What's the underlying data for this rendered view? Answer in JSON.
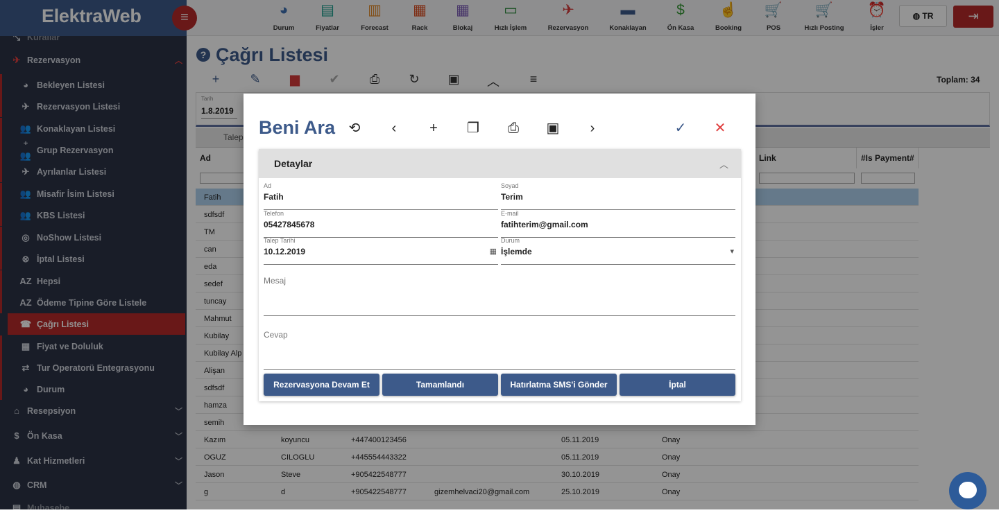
{
  "app": {
    "logo": "ElektraWeb",
    "menu_icon": "hamburger-icon"
  },
  "sidebar": {
    "partial_top": "Kurallar",
    "reservation_section": "Rezervasyon",
    "items": [
      {
        "label": "Bekleyen Listesi",
        "icon": "pie-icon"
      },
      {
        "label": "Rezervasyon Listesi",
        "icon": "plane-land-icon"
      },
      {
        "label": "Konaklayan Listesi",
        "icon": "people-icon"
      },
      {
        "label": "Grup Rezervasyon",
        "icon": "group-add-icon"
      },
      {
        "label": "Ayrılanlar Listesi",
        "icon": "plane-takeoff-icon"
      },
      {
        "label": "Misafir İsim Listesi",
        "icon": "people-outline-icon"
      },
      {
        "label": "KBS Listesi",
        "icon": "people-outline-icon"
      },
      {
        "label": "NoShow Listesi",
        "icon": "eye-off-icon"
      },
      {
        "label": "İptal Listesi",
        "icon": "cancel-icon"
      },
      {
        "label": "Hepsi",
        "icon": "az-icon"
      },
      {
        "label": "Ödeme Tipine Göre Listele",
        "icon": "az-icon"
      },
      {
        "label": "Çağrı Listesi",
        "icon": "phone-icon"
      },
      {
        "label": "Fiyat ve Doluluk",
        "icon": "calendar-icon"
      },
      {
        "label": "Tur Operatorü Entegrasyonu",
        "icon": "swap-icon"
      },
      {
        "label": "Durum",
        "icon": "pie-icon"
      }
    ],
    "sections": [
      {
        "label": "Resepsiyon",
        "icon": "home-icon"
      },
      {
        "label": "Ön Kasa",
        "icon": "dollar-icon"
      },
      {
        "label": "Kat Hizmetleri",
        "icon": "person-icon"
      },
      {
        "label": "CRM",
        "icon": "globe-icon"
      }
    ],
    "partial_bottom": "Muhasebe"
  },
  "toolbar": [
    {
      "label": "Durum",
      "icon": "pie-chart-icon",
      "color": "#3d6fb0"
    },
    {
      "label": "Fiyatlar",
      "icon": "price-board-icon",
      "color": "#1a9e8c"
    },
    {
      "label": "Forecast",
      "icon": "bar-chart-icon",
      "color": "#e08a2c"
    },
    {
      "label": "Rack",
      "icon": "grid-icon",
      "color": "#d94c1f"
    },
    {
      "label": "Blokaj",
      "icon": "calendar-icon",
      "color": "#7a5bb5"
    },
    {
      "label": "Hızlı İşlem",
      "icon": "laptop-icon",
      "color": "#2a8a3a"
    },
    {
      "label": "Rezervasyon",
      "icon": "plane-icon",
      "color": "#d43a3a"
    },
    {
      "label": "Konaklayan",
      "icon": "bed-icon",
      "color": "#3d5a8a"
    },
    {
      "label": "Ön Kasa",
      "icon": "dollar-icon",
      "color": "#3a9a3a"
    },
    {
      "label": "Booking",
      "icon": "hand-icon",
      "color": "#d6407a"
    },
    {
      "label": "POS",
      "icon": "cart-icon",
      "color": "#e04a2a"
    },
    {
      "label": "Hızlı Posting",
      "icon": "cart-icon",
      "color": "#8a3ac8"
    },
    {
      "label": "İşler",
      "icon": "alarm-icon",
      "color": "#d43a3a"
    }
  ],
  "language": "TR",
  "page": {
    "title": "Çağrı Listesi",
    "total": "Toplam: 34"
  },
  "filter": {
    "date_label": "Tarih",
    "date_value": "1.8.2019"
  },
  "tab_label": "Talep",
  "grid": {
    "headers": [
      "Ad",
      "Link",
      "#Is Payment#"
    ],
    "rows": [
      {
        "ad": "Fatih",
        "soyad": "",
        "tel": "",
        "mail": "",
        "tarih": "",
        "durum": ""
      },
      {
        "ad": "sdfsdf",
        "soyad": "",
        "tel": "",
        "mail": "",
        "tarih": "",
        "durum": ""
      },
      {
        "ad": "TM",
        "soyad": "",
        "tel": "",
        "mail": "",
        "tarih": "",
        "durum": ""
      },
      {
        "ad": "can",
        "soyad": "",
        "tel": "",
        "mail": "",
        "tarih": "",
        "durum": ""
      },
      {
        "ad": "eda",
        "soyad": "",
        "tel": "",
        "mail": "",
        "tarih": "",
        "durum": ""
      },
      {
        "ad": "sedef",
        "soyad": "",
        "tel": "",
        "mail": "",
        "tarih": "",
        "durum": ""
      },
      {
        "ad": "tuncay",
        "soyad": "",
        "tel": "",
        "mail": "",
        "tarih": "",
        "durum": ""
      },
      {
        "ad": "Mahmut",
        "soyad": "",
        "tel": "",
        "mail": "",
        "tarih": "",
        "durum": ""
      },
      {
        "ad": "Kubilay",
        "soyad": "",
        "tel": "",
        "mail": "",
        "tarih": "",
        "durum": ""
      },
      {
        "ad": "Kubilay Alp",
        "soyad": "",
        "tel": "",
        "mail": "",
        "tarih": "",
        "durum": ""
      },
      {
        "ad": "Alişan",
        "soyad": "",
        "tel": "",
        "mail": "",
        "tarih": "",
        "durum": ""
      },
      {
        "ad": "sdfsdf",
        "soyad": "",
        "tel": "",
        "mail": "",
        "tarih": "",
        "durum": ""
      },
      {
        "ad": "hamza",
        "soyad": "",
        "tel": "",
        "mail": "",
        "tarih": "",
        "durum": ""
      },
      {
        "ad": "semih",
        "soyad": "",
        "tel": "",
        "mail": "",
        "tarih": "",
        "durum": ""
      },
      {
        "ad": "Kazım",
        "soyad": "koyuncu",
        "tel": "+447400123456",
        "mail": "",
        "tarih": "05.11.2019",
        "durum": "Onay"
      },
      {
        "ad": "OGUZ",
        "soyad": "CILOGLU",
        "tel": "+445554443322",
        "mail": "",
        "tarih": "05.11.2019",
        "durum": "Onay"
      },
      {
        "ad": "Jason",
        "soyad": "Steve",
        "tel": "+905422548777",
        "mail": "",
        "tarih": "30.10.2019",
        "durum": "Onay"
      },
      {
        "ad": "g",
        "soyad": "d",
        "tel": "+905422548777",
        "mail": "gizemhelvaci20@gmail.com",
        "tarih": "25.10.2019",
        "durum": "Onay"
      }
    ]
  },
  "modal": {
    "title": "Beni Ara",
    "section": "Detaylar",
    "fields": {
      "ad": {
        "label": "Ad",
        "value": "Fatih"
      },
      "soyad": {
        "label": "Soyad",
        "value": "Terim"
      },
      "telefon": {
        "label": "Telefon",
        "value": "05427845678"
      },
      "email": {
        "label": "E-mail",
        "value": "fatihterim@gmail.com"
      },
      "talep_tarihi": {
        "label": "Talep Tarihi",
        "value": "10.12.2019"
      },
      "durum": {
        "label": "Durum",
        "value": "İşlemde"
      },
      "mesaj": {
        "label": "Mesaj"
      },
      "cevap": {
        "label": "Cevap"
      }
    },
    "buttons": {
      "continue": "Rezervasyona Devam Et",
      "complete": "Tamamlandı",
      "sms": "Hatırlatma SMS'i Gönder",
      "cancel": "İptal"
    }
  }
}
